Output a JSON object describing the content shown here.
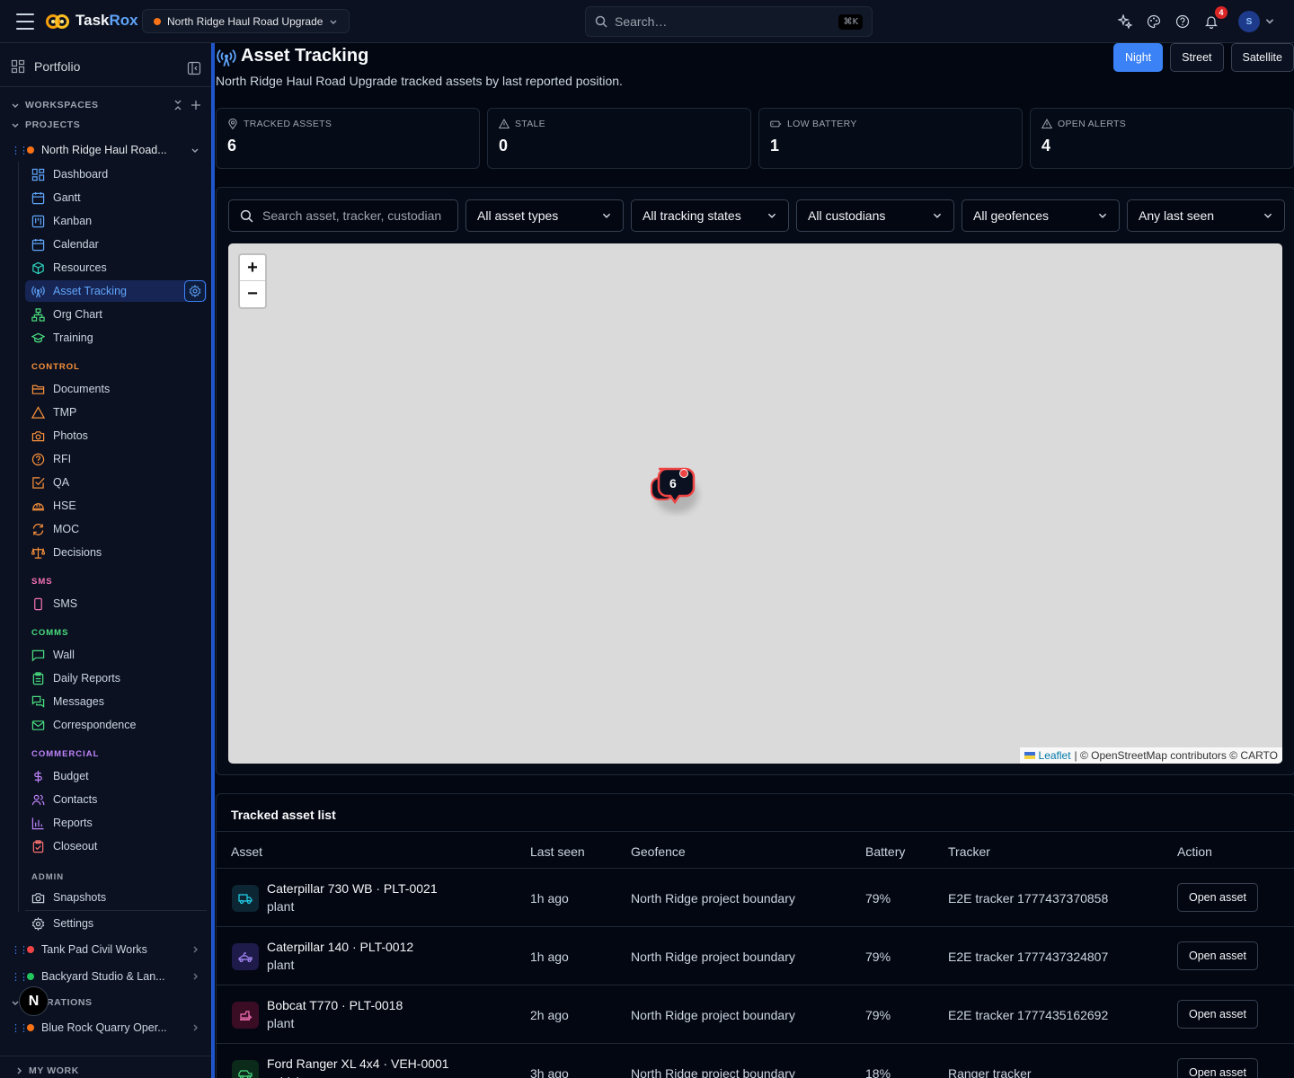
{
  "app": {
    "brand_prefix": "Task",
    "brand_suffix": "Rox"
  },
  "topbar": {
    "project_name": "North Ridge Haul Road Upgrade",
    "search_placeholder": "Search…",
    "search_shortcut": "⌘K",
    "notification_count": "4",
    "avatar_initial": "S",
    "project_dot_color": "#f97316"
  },
  "sidebar": {
    "portfolio_label": "Portfolio",
    "workspaces_label": "WORKSPACES",
    "projects_label": "PROJECTS",
    "active_project": "North Ridge Haul Road...",
    "nav": [
      {
        "label": "Dashboard",
        "icon": "dashboard-icon"
      },
      {
        "label": "Gantt",
        "icon": "calendar-icon"
      },
      {
        "label": "Kanban",
        "icon": "kanban-icon"
      },
      {
        "label": "Calendar",
        "icon": "calendar-icon"
      },
      {
        "label": "Resources",
        "icon": "cube-icon"
      },
      {
        "label": "Asset Tracking",
        "icon": "radio-tower-icon"
      },
      {
        "label": "Org Chart",
        "icon": "org-chart-icon"
      },
      {
        "label": "Training",
        "icon": "graduation-cap-icon"
      }
    ],
    "control_label": "CONTROL",
    "control": [
      {
        "label": "Documents",
        "icon": "folder-icon"
      },
      {
        "label": "TMP",
        "icon": "warning-triangle-icon"
      },
      {
        "label": "Photos",
        "icon": "camera-icon"
      },
      {
        "label": "RFI",
        "icon": "help-circle-icon"
      },
      {
        "label": "QA",
        "icon": "check-square-icon"
      },
      {
        "label": "HSE",
        "icon": "hard-hat-icon"
      },
      {
        "label": "MOC",
        "icon": "refresh-icon"
      },
      {
        "label": "Decisions",
        "icon": "scale-icon"
      }
    ],
    "sms_label": "SMS",
    "sms": [
      {
        "label": "SMS",
        "icon": "phone-icon"
      }
    ],
    "comms_label": "COMMS",
    "comms": [
      {
        "label": "Wall",
        "icon": "message-square-icon"
      },
      {
        "label": "Daily Reports",
        "icon": "clipboard-icon"
      },
      {
        "label": "Messages",
        "icon": "messages-icon"
      },
      {
        "label": "Correspondence",
        "icon": "mail-icon"
      }
    ],
    "commercial_label": "COMMERCIAL",
    "commercial": [
      {
        "label": "Budget",
        "icon": "dollar-icon"
      },
      {
        "label": "Contacts",
        "icon": "users-icon"
      },
      {
        "label": "Reports",
        "icon": "bar-chart-icon"
      },
      {
        "label": "Closeout",
        "icon": "clipboard-check-icon"
      }
    ],
    "admin_label": "ADMIN",
    "admin": [
      {
        "label": "Snapshots",
        "icon": "camera-icon"
      },
      {
        "label": "Settings",
        "icon": "gear-icon"
      }
    ],
    "other_projects": [
      {
        "label": "Tank Pad Civil Works",
        "dot": "#ef4444"
      },
      {
        "label": "Backyard Studio & Lan...",
        "dot": "#22c55e"
      }
    ],
    "operations_label": "OPERATIONS",
    "operations_project": "Blue Rock Quarry Oper...",
    "my_work_label": "MY WORK",
    "n_badge": "N"
  },
  "page": {
    "title": "Asset Tracking",
    "subtitle": "North Ridge Haul Road Upgrade tracked assets by last reported position.",
    "layers": [
      "Night",
      "Street",
      "Satellite"
    ],
    "active_layer": "Night"
  },
  "stats": [
    {
      "label": "TRACKED ASSETS",
      "value": "6",
      "icon": "map-pin-icon"
    },
    {
      "label": "STALE",
      "value": "0",
      "icon": "warning-triangle-icon"
    },
    {
      "label": "LOW BATTERY",
      "value": "1",
      "icon": "battery-icon"
    },
    {
      "label": "OPEN ALERTS",
      "value": "4",
      "icon": "warning-triangle-icon"
    }
  ],
  "filters": {
    "search_placeholder": "Search asset, tracker, custodian",
    "asset_types": "All asset types",
    "tracking_states": "All tracking states",
    "custodians": "All custodians",
    "geofences": "All geofences",
    "last_seen": "Any last seen"
  },
  "map": {
    "zoom_in": "+",
    "zoom_out": "−",
    "cluster_count": "6",
    "attribution_link": "Leaflet",
    "attribution_text": "| © OpenStreetMap contributors © CARTO"
  },
  "asset_list": {
    "title": "Tracked asset list",
    "columns": [
      "Asset",
      "Last seen",
      "Geofence",
      "Battery",
      "Tracker",
      "Action"
    ],
    "rows": [
      {
        "name": "Caterpillar 730 WB · PLT-0021",
        "type": "plant",
        "last_seen": "1h ago",
        "geofence": "North Ridge project boundary",
        "battery": "79%",
        "tracker": "E2E tracker 1777437370858",
        "action": "Open asset",
        "icon": "truck-icon",
        "icon_color": "#22d3ee",
        "icon_bg": "#0c2733"
      },
      {
        "name": "Caterpillar 140 · PLT-0012",
        "type": "plant",
        "last_seen": "1h ago",
        "geofence": "North Ridge project boundary",
        "battery": "79%",
        "tracker": "E2E tracker 1777437324807",
        "action": "Open asset",
        "icon": "grader-icon",
        "icon_color": "#a78bfa",
        "icon_bg": "#1e1b4b"
      },
      {
        "name": "Bobcat T770 · PLT-0018",
        "type": "plant",
        "last_seen": "2h ago",
        "geofence": "North Ridge project boundary",
        "battery": "79%",
        "tracker": "E2E tracker 1777435162692",
        "action": "Open asset",
        "icon": "loader-icon",
        "icon_color": "#f472b6",
        "icon_bg": "#3b0d25"
      },
      {
        "name": "Ford Ranger XL 4x4 · VEH-0001",
        "type": "vehicle",
        "last_seen": "3h ago",
        "geofence": "North Ridge project boundary",
        "battery": "18%",
        "tracker": "Ranger tracker",
        "action": "Open asset",
        "icon": "vehicle-icon",
        "icon_color": "#4ade80",
        "icon_bg": "#0b2a1a"
      }
    ]
  }
}
